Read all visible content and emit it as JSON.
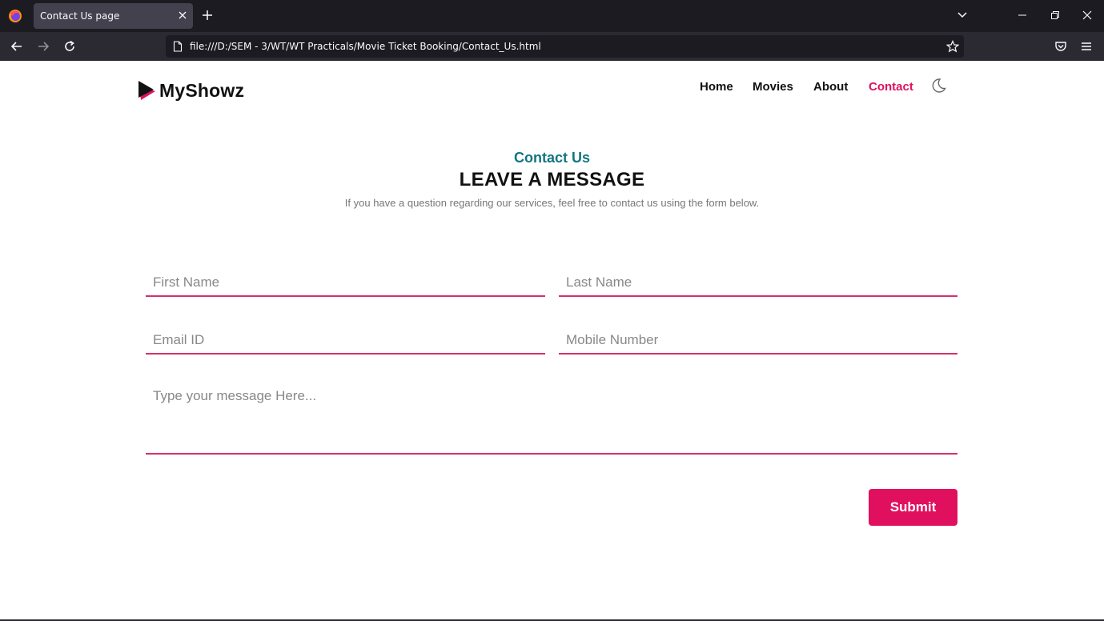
{
  "browser": {
    "tab_title": "Contact Us page",
    "url": "file:///D:/SEM - 3/WT/WT Practicals/Movie Ticket Booking/Contact_Us.html"
  },
  "site": {
    "brand": "MyShowz",
    "nav": [
      {
        "label": "Home",
        "active": false
      },
      {
        "label": "Movies",
        "active": false
      },
      {
        "label": "About",
        "active": false
      },
      {
        "label": "Contact",
        "active": true
      }
    ],
    "theme_toggle_icon": "moon-icon"
  },
  "contact": {
    "eyebrow": "Contact Us",
    "headline": "LEAVE A MESSAGE",
    "subtext": "If you have a question regarding our services, feel free to contact us using the form below.",
    "form": {
      "first_name": {
        "placeholder": "First Name",
        "value": ""
      },
      "last_name": {
        "placeholder": "Last Name",
        "value": ""
      },
      "email": {
        "placeholder": "Email ID",
        "value": ""
      },
      "mobile": {
        "placeholder": "Mobile Number",
        "value": ""
      },
      "message": {
        "placeholder": "Type your message Here...",
        "value": ""
      },
      "submit_label": "Submit"
    }
  },
  "colors": {
    "accent": "#e0105f",
    "teal": "#127681",
    "browser_dark": "#1c1b22",
    "browser_toolbar": "#2b2a33"
  }
}
